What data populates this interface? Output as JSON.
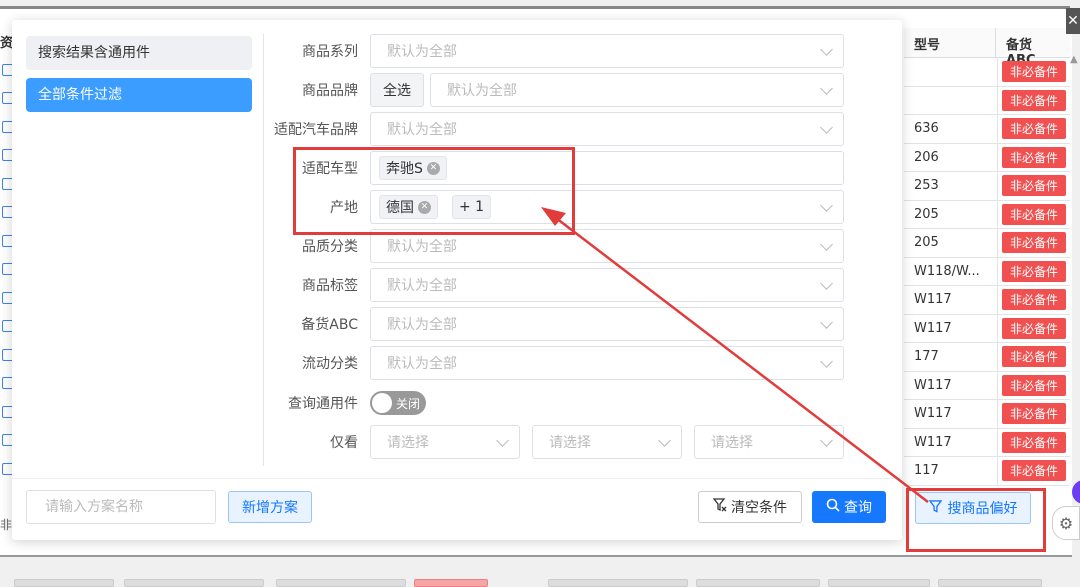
{
  "background": {
    "left_header": "资",
    "left_bottom_text": "非",
    "table": {
      "headers": [
        "型号",
        "备货ABC"
      ],
      "rows": [
        {
          "model": "",
          "abc": "非必备件"
        },
        {
          "model": "",
          "abc": "非必备件"
        },
        {
          "model": "636",
          "abc": "非必备件"
        },
        {
          "model": "206",
          "abc": "非必备件"
        },
        {
          "model": "253",
          "abc": "非必备件"
        },
        {
          "model": "205",
          "abc": "非必备件"
        },
        {
          "model": "205",
          "abc": "非必备件"
        },
        {
          "model": "W118/W...",
          "abc": "非必备件"
        },
        {
          "model": "W117",
          "abc": "非必备件"
        },
        {
          "model": "W117",
          "abc": "非必备件"
        },
        {
          "model": "177",
          "abc": "非必备件"
        },
        {
          "model": "W117",
          "abc": "非必备件"
        },
        {
          "model": "W117",
          "abc": "非必备件"
        },
        {
          "model": "W117",
          "abc": "非必备件"
        },
        {
          "model": "117",
          "abc": "非必备件"
        }
      ]
    },
    "close_label": "✕",
    "search_pref_button": "搜商品偏好",
    "gear": "⚙"
  },
  "modal": {
    "menu": [
      {
        "label": "搜索结果含通用件",
        "active": false
      },
      {
        "label": "全部条件过滤",
        "active": true
      }
    ],
    "fields": {
      "series": {
        "label": "商品系列",
        "placeholder": "默认为全部"
      },
      "brand": {
        "label": "商品品牌",
        "select_all": "全选",
        "placeholder": "默认为全部"
      },
      "car_brand": {
        "label": "适配汽车品牌",
        "placeholder": "默认为全部"
      },
      "car_model": {
        "label": "适配车型",
        "chips": [
          "奔驰S"
        ]
      },
      "origin": {
        "label": "产地",
        "chips": [
          "德国"
        ],
        "more": "+ 1"
      },
      "quality": {
        "label": "品质分类",
        "placeholder": "默认为全部"
      },
      "tag": {
        "label": "商品标签",
        "placeholder": "默认为全部"
      },
      "stock_abc": {
        "label": "备货ABC",
        "placeholder": "默认为全部"
      },
      "flow": {
        "label": "流动分类",
        "placeholder": "默认为全部"
      },
      "universal": {
        "label": "查询通用件",
        "toggle_text": "关闭"
      },
      "only_view": {
        "label": "仅看",
        "selects": [
          "请选择",
          "请选择",
          "请选择"
        ]
      }
    },
    "footer": {
      "scheme_placeholder": "请输入方案名称",
      "new_scheme": "新增方案",
      "clear": "清空条件",
      "query": "查询"
    }
  },
  "colors": {
    "primary": "#1677ff",
    "menu_active": "#3b9dff",
    "annotation_red": "#e23b3b",
    "tag_red": "#f05050"
  }
}
